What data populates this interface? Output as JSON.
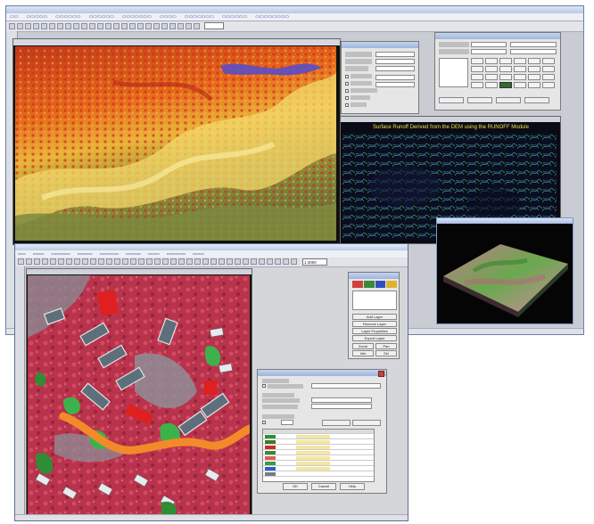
{
  "front_window": {
    "zoom_value": "1:4000"
  },
  "tools_panel": {
    "buttons": [
      "Add Layer",
      "Remove Layer",
      "Layer Properties",
      "Export Layer"
    ],
    "small_buttons": [
      "Zoom",
      "Pan",
      "Info",
      "Sel"
    ]
  },
  "classification_dialog": {
    "buttons": [
      "OK",
      "Cancel",
      "Help"
    ]
  },
  "runoff_window": {
    "title": "Surface Runoff Derived from the DEM using the RUNOFF Module"
  },
  "colors": {
    "accent": "#1a3a8a",
    "runoff_title": "#e8e24a"
  },
  "class_table": {
    "swatches": [
      "#2f8f3a",
      "#3b7a2a",
      "#c92a2a",
      "#2f8f3a",
      "#e35a5a",
      "#3f9a3f",
      "#2a5fd0",
      "#7a7a7a"
    ]
  }
}
